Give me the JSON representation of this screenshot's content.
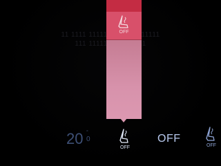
{
  "background": {
    "line_1": "11 1111 111111 11 11 1111111",
    "line_2": "111 11111 111 111111"
  },
  "seat_heat_popup": {
    "levels": [
      {
        "level": 3,
        "color": "#c42c43"
      },
      {
        "level": 2,
        "color": "#d8506a",
        "label": "OFF",
        "icon": "heated-seat-icon"
      },
      {
        "level": 1,
        "color": "#a13a4f"
      },
      {
        "level": 0,
        "color": "#dc98b1"
      }
    ]
  },
  "climate_bar": {
    "temperature": {
      "value": "20",
      "decimal": "0",
      "unit_symbol": "°",
      "color": "#3d4f75"
    },
    "driver_seat_heat": {
      "label": "OFF",
      "icon": "heated-seat-icon",
      "active": true
    },
    "fan": {
      "state": "OFF",
      "color": "#b8c9ee"
    },
    "passenger_seat_heat": {
      "label": "OFF",
      "icon": "heated-seat-icon"
    }
  }
}
